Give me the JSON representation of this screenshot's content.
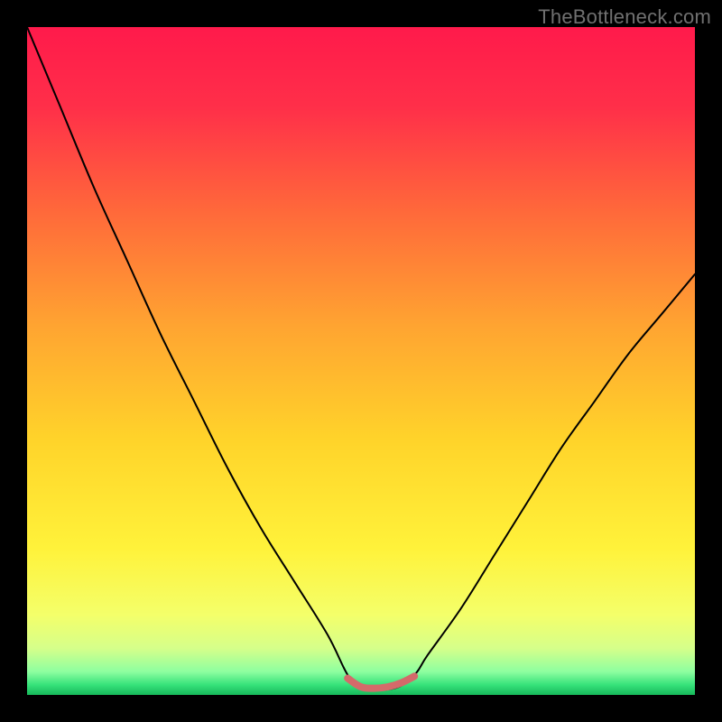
{
  "watermark": "TheBottleneck.com",
  "chart_data": {
    "type": "line",
    "title": "",
    "xlabel": "",
    "ylabel": "",
    "xlim": [
      0,
      1
    ],
    "ylim": [
      0,
      1
    ],
    "grid": false,
    "series": [
      {
        "name": "bottleneck-curve",
        "x": [
          0.0,
          0.05,
          0.1,
          0.15,
          0.2,
          0.25,
          0.3,
          0.35,
          0.4,
          0.45,
          0.48,
          0.5,
          0.55,
          0.58,
          0.6,
          0.65,
          0.7,
          0.75,
          0.8,
          0.85,
          0.9,
          0.95,
          1.0
        ],
        "y": [
          1.0,
          0.88,
          0.76,
          0.65,
          0.54,
          0.44,
          0.34,
          0.25,
          0.17,
          0.09,
          0.03,
          0.01,
          0.01,
          0.03,
          0.06,
          0.13,
          0.21,
          0.29,
          0.37,
          0.44,
          0.51,
          0.57,
          0.63
        ],
        "color": "#000000",
        "linewidth": 2
      },
      {
        "name": "optimal-zone-highlight",
        "x": [
          0.48,
          0.5,
          0.52,
          0.54,
          0.56,
          0.58
        ],
        "y": [
          0.025,
          0.012,
          0.01,
          0.012,
          0.018,
          0.028
        ],
        "color": "#d46a6a",
        "linewidth": 8
      }
    ],
    "background_gradient": {
      "stops": [
        {
          "offset": 0.0,
          "color": "#ff1a4b"
        },
        {
          "offset": 0.12,
          "color": "#ff2f49"
        },
        {
          "offset": 0.28,
          "color": "#ff6a3a"
        },
        {
          "offset": 0.45,
          "color": "#ffa531"
        },
        {
          "offset": 0.62,
          "color": "#ffd42a"
        },
        {
          "offset": 0.78,
          "color": "#fff23a"
        },
        {
          "offset": 0.88,
          "color": "#f4ff6a"
        },
        {
          "offset": 0.93,
          "color": "#d6ff8a"
        },
        {
          "offset": 0.965,
          "color": "#8effa0"
        },
        {
          "offset": 0.985,
          "color": "#36e27a"
        },
        {
          "offset": 1.0,
          "color": "#16b85a"
        }
      ]
    }
  }
}
